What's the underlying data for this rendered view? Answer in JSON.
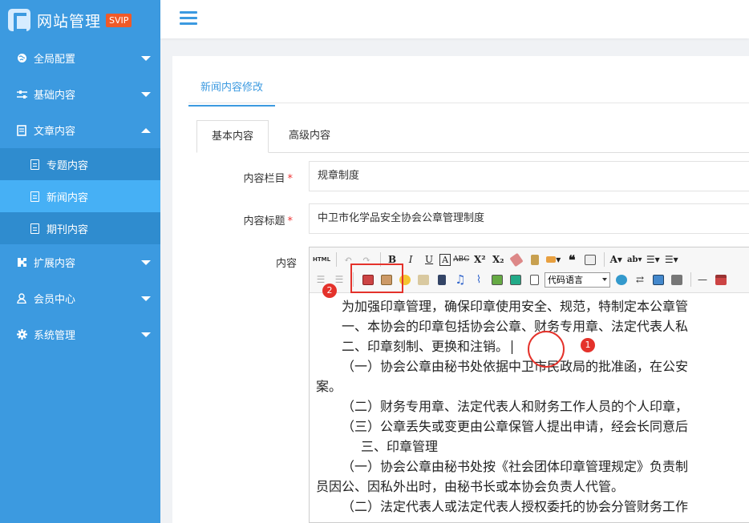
{
  "brand": {
    "title": "网站管理",
    "badge": "SVIP"
  },
  "sidebar": {
    "items": [
      {
        "label": "全局配置"
      },
      {
        "label": "基础内容"
      },
      {
        "label": "文章内容"
      },
      {
        "label": "扩展内容"
      },
      {
        "label": "会员中心"
      },
      {
        "label": "系统管理"
      }
    ],
    "subitems": [
      {
        "label": "专题内容"
      },
      {
        "label": "新闻内容"
      },
      {
        "label": "期刊内容"
      }
    ]
  },
  "panel": {
    "tab": "新闻内容修改",
    "subtabs": [
      "基本内容",
      "高级内容"
    ]
  },
  "form": {
    "column_label": "内容栏目",
    "column_value": "规章制度",
    "title_label": "内容标题",
    "title_value": "中卫市化学品安全协会公章管理制度",
    "content_label": "内容",
    "required_mark": "*"
  },
  "toolbar": {
    "html_label": "HTML",
    "code_lang": "代码语言"
  },
  "editor": {
    "lines": [
      "为加强印章管理，确保印章使用安全、规范，特制定本公章管",
      "一、本协会的印章包括协会公章、财务专用章、法定代表人私",
      "二、印章刻制、更换和注销。",
      "（一）协会公章由秘书处依据中卫市民政局的批准函，在公安",
      "案。",
      "（二）财务专用章、法定代表人和财务工作人员的个人印章，",
      "（三）公章丢失或变更由公章保管人提出申请，经会长同意后",
      "三、印章管理",
      "（一）协会公章由秘书处按《社会团体印章管理规定》负责制",
      "员因公、因私外出时，由秘书长或本协会负责人代管。",
      "（二）法定代表人或法定代表人授权委托的协会分管财务工作"
    ]
  },
  "annotations": {
    "one": "1",
    "two": "2"
  },
  "colors": {
    "sidebar": "#3c9ae0",
    "active": "#46b0f5",
    "annotation": "#e4322b",
    "badge": "#f05a28"
  }
}
